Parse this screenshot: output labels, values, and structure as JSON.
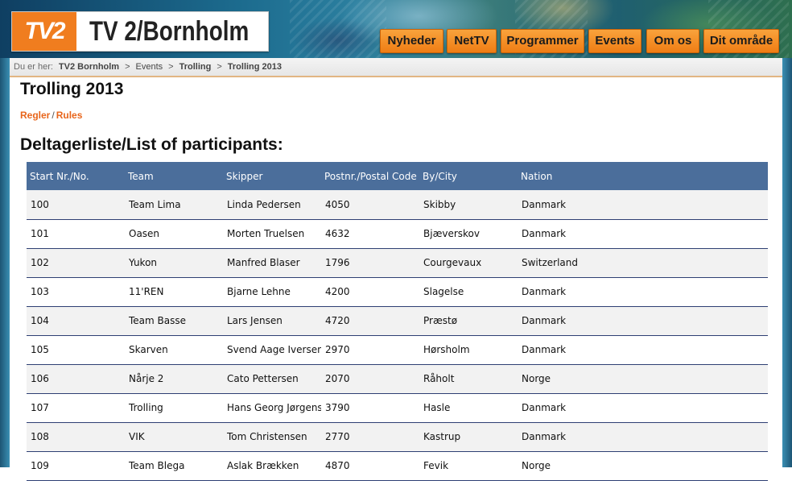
{
  "brand": {
    "logo_mark": "TV2",
    "site_name": "TV 2/Bornholm"
  },
  "nav": {
    "items": [
      {
        "label": "Nyheder"
      },
      {
        "label": "NetTV"
      },
      {
        "label": "Programmer"
      },
      {
        "label": "Events"
      },
      {
        "label": "Om os"
      },
      {
        "label": "Dit område"
      }
    ]
  },
  "breadcrumb": {
    "prefix": "Du er her:",
    "items": [
      {
        "label": "TV2 Bornholm"
      },
      {
        "label": "Events"
      },
      {
        "label": "Trolling"
      },
      {
        "label": "Trolling 2013"
      }
    ],
    "separator": ">"
  },
  "page": {
    "title": "Trolling 2013",
    "rules_da": "Regler",
    "rules_sep": "/",
    "rules_en": "Rules",
    "section_title": "Deltagerliste/List of participants:"
  },
  "table": {
    "columns": [
      "Start Nr./No.",
      "Team",
      "Skipper",
      "Postnr./Postal Code",
      "By/City",
      "Nation"
    ],
    "rows": [
      [
        "100",
        "Team Lima",
        "Linda Pedersen",
        "4050",
        "Skibby",
        "Danmark"
      ],
      [
        "101",
        "Oasen",
        "Morten  Truelsen",
        "4632",
        "Bjæverskov",
        "Danmark"
      ],
      [
        "102",
        "Yukon",
        "Manfred Blaser",
        "1796",
        "Courgevaux",
        "Switzerland"
      ],
      [
        "103",
        "11'REN",
        "Bjarne Lehne",
        "4200",
        "Slagelse",
        "Danmark"
      ],
      [
        "104",
        "Team Basse",
        "Lars Jensen",
        "4720",
        "Præstø",
        "Danmark"
      ],
      [
        "105",
        "Skarven",
        "Svend Aage Iversen",
        "2970",
        "Hørsholm",
        "Danmark"
      ],
      [
        "106",
        "Nårje 2",
        "Cato Pettersen",
        "2070",
        "Råholt",
        "Norge"
      ],
      [
        "107",
        "Trolling",
        "Hans Georg Jørgensen",
        "3790",
        "Hasle",
        "Danmark"
      ],
      [
        "108",
        "VIK",
        "Tom  Christensen",
        "2770",
        "Kastrup",
        "Danmark"
      ],
      [
        "109",
        "Team Blega",
        "Aslak Brækken",
        "4870",
        "Fevik",
        "Norge"
      ]
    ]
  },
  "colors": {
    "accent_orange": "#f08a1c",
    "table_header": "#4b6e9b",
    "link": "#e8651b"
  }
}
